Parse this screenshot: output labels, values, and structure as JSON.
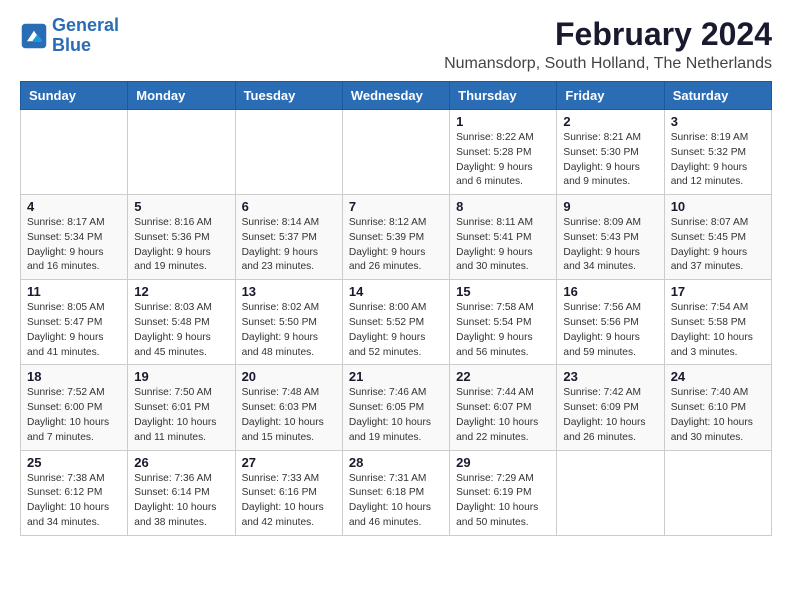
{
  "logo": {
    "line1": "General",
    "line2": "Blue"
  },
  "title": "February 2024",
  "subtitle": "Numansdorp, South Holland, The Netherlands",
  "days_header": [
    "Sunday",
    "Monday",
    "Tuesday",
    "Wednesday",
    "Thursday",
    "Friday",
    "Saturday"
  ],
  "weeks": [
    [
      {
        "day": "",
        "info": ""
      },
      {
        "day": "",
        "info": ""
      },
      {
        "day": "",
        "info": ""
      },
      {
        "day": "",
        "info": ""
      },
      {
        "day": "1",
        "info": "Sunrise: 8:22 AM\nSunset: 5:28 PM\nDaylight: 9 hours\nand 6 minutes."
      },
      {
        "day": "2",
        "info": "Sunrise: 8:21 AM\nSunset: 5:30 PM\nDaylight: 9 hours\nand 9 minutes."
      },
      {
        "day": "3",
        "info": "Sunrise: 8:19 AM\nSunset: 5:32 PM\nDaylight: 9 hours\nand 12 minutes."
      }
    ],
    [
      {
        "day": "4",
        "info": "Sunrise: 8:17 AM\nSunset: 5:34 PM\nDaylight: 9 hours\nand 16 minutes."
      },
      {
        "day": "5",
        "info": "Sunrise: 8:16 AM\nSunset: 5:36 PM\nDaylight: 9 hours\nand 19 minutes."
      },
      {
        "day": "6",
        "info": "Sunrise: 8:14 AM\nSunset: 5:37 PM\nDaylight: 9 hours\nand 23 minutes."
      },
      {
        "day": "7",
        "info": "Sunrise: 8:12 AM\nSunset: 5:39 PM\nDaylight: 9 hours\nand 26 minutes."
      },
      {
        "day": "8",
        "info": "Sunrise: 8:11 AM\nSunset: 5:41 PM\nDaylight: 9 hours\nand 30 minutes."
      },
      {
        "day": "9",
        "info": "Sunrise: 8:09 AM\nSunset: 5:43 PM\nDaylight: 9 hours\nand 34 minutes."
      },
      {
        "day": "10",
        "info": "Sunrise: 8:07 AM\nSunset: 5:45 PM\nDaylight: 9 hours\nand 37 minutes."
      }
    ],
    [
      {
        "day": "11",
        "info": "Sunrise: 8:05 AM\nSunset: 5:47 PM\nDaylight: 9 hours\nand 41 minutes."
      },
      {
        "day": "12",
        "info": "Sunrise: 8:03 AM\nSunset: 5:48 PM\nDaylight: 9 hours\nand 45 minutes."
      },
      {
        "day": "13",
        "info": "Sunrise: 8:02 AM\nSunset: 5:50 PM\nDaylight: 9 hours\nand 48 minutes."
      },
      {
        "day": "14",
        "info": "Sunrise: 8:00 AM\nSunset: 5:52 PM\nDaylight: 9 hours\nand 52 minutes."
      },
      {
        "day": "15",
        "info": "Sunrise: 7:58 AM\nSunset: 5:54 PM\nDaylight: 9 hours\nand 56 minutes."
      },
      {
        "day": "16",
        "info": "Sunrise: 7:56 AM\nSunset: 5:56 PM\nDaylight: 9 hours\nand 59 minutes."
      },
      {
        "day": "17",
        "info": "Sunrise: 7:54 AM\nSunset: 5:58 PM\nDaylight: 10 hours\nand 3 minutes."
      }
    ],
    [
      {
        "day": "18",
        "info": "Sunrise: 7:52 AM\nSunset: 6:00 PM\nDaylight: 10 hours\nand 7 minutes."
      },
      {
        "day": "19",
        "info": "Sunrise: 7:50 AM\nSunset: 6:01 PM\nDaylight: 10 hours\nand 11 minutes."
      },
      {
        "day": "20",
        "info": "Sunrise: 7:48 AM\nSunset: 6:03 PM\nDaylight: 10 hours\nand 15 minutes."
      },
      {
        "day": "21",
        "info": "Sunrise: 7:46 AM\nSunset: 6:05 PM\nDaylight: 10 hours\nand 19 minutes."
      },
      {
        "day": "22",
        "info": "Sunrise: 7:44 AM\nSunset: 6:07 PM\nDaylight: 10 hours\nand 22 minutes."
      },
      {
        "day": "23",
        "info": "Sunrise: 7:42 AM\nSunset: 6:09 PM\nDaylight: 10 hours\nand 26 minutes."
      },
      {
        "day": "24",
        "info": "Sunrise: 7:40 AM\nSunset: 6:10 PM\nDaylight: 10 hours\nand 30 minutes."
      }
    ],
    [
      {
        "day": "25",
        "info": "Sunrise: 7:38 AM\nSunset: 6:12 PM\nDaylight: 10 hours\nand 34 minutes."
      },
      {
        "day": "26",
        "info": "Sunrise: 7:36 AM\nSunset: 6:14 PM\nDaylight: 10 hours\nand 38 minutes."
      },
      {
        "day": "27",
        "info": "Sunrise: 7:33 AM\nSunset: 6:16 PM\nDaylight: 10 hours\nand 42 minutes."
      },
      {
        "day": "28",
        "info": "Sunrise: 7:31 AM\nSunset: 6:18 PM\nDaylight: 10 hours\nand 46 minutes."
      },
      {
        "day": "29",
        "info": "Sunrise: 7:29 AM\nSunset: 6:19 PM\nDaylight: 10 hours\nand 50 minutes."
      },
      {
        "day": "",
        "info": ""
      },
      {
        "day": "",
        "info": ""
      }
    ]
  ]
}
